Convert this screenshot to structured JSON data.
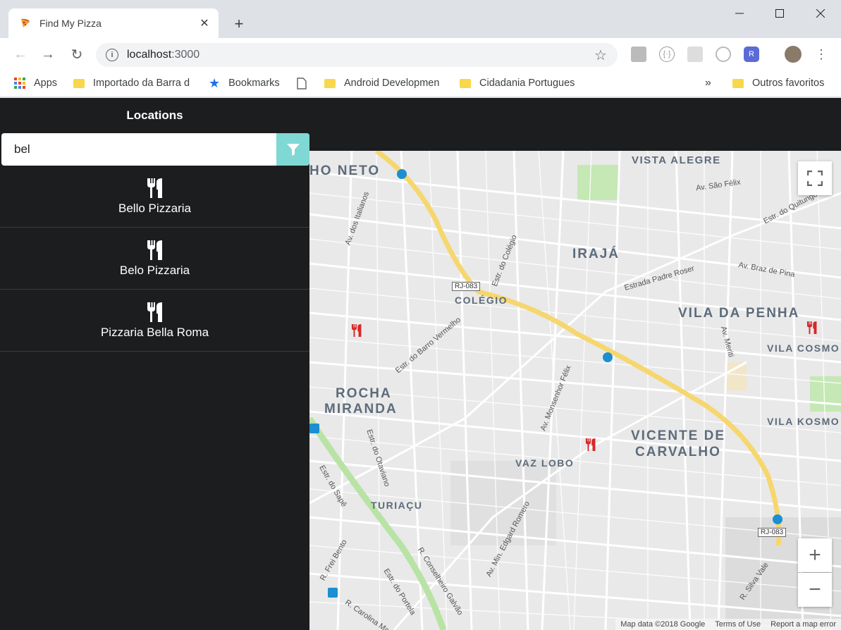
{
  "browser": {
    "tab_title": "Find My Pizza",
    "url_host": "localhost",
    "url_port": ":3000",
    "bookmarks": [
      "Apps",
      "Importado da Barra d",
      "Bookmarks",
      "Android Developmen",
      "Cidadania Portugues",
      "Outros favoritos"
    ],
    "overflow_label": "»"
  },
  "app": {
    "sidebar_title": "Locations",
    "search_value": "bel",
    "results": [
      {
        "name": "Bello Pizzaria"
      },
      {
        "name": "Belo Pizzaria"
      },
      {
        "name": "Pizzaria Bella Roma"
      }
    ]
  },
  "map": {
    "labels": [
      "HO NETO",
      "VISTA ALEGRE",
      "Av. São Félix",
      "Estr. do Quitungo",
      "Av. dos Italianos",
      "IRAJÁ",
      "Estr. do Colégio",
      "RJ-083",
      "Estrada Padre Roser",
      "Av. Braz de Pina",
      "COLÉGIO",
      "VILA DA PENHA",
      "VILA COSMO",
      "Estr. do Barro Vermelho",
      "Av. Monsenhor Félix",
      "ROCHA",
      "MIRANDA",
      "VILA KOSMO",
      "VICENTE DE",
      "CARVALHO",
      "VAZ LOBO",
      "Estr. do Otaviano",
      "TURIAÇU",
      "Estr. do Sapê",
      "Av. Min. Edgard Romero",
      "R. Conselheiro Galvão",
      "R. Frei Bento",
      "Estr. do Portela",
      "R. Carolina Ma",
      "R. Silva Vale",
      "Av. Meriti"
    ],
    "zoom_in": "+",
    "zoom_out": "−",
    "attribution": [
      "Map data ©2018 Google",
      "Terms of Use",
      "Report a map error"
    ],
    "colors": {
      "road_major": "#f6d76f",
      "park": "#c5e8b5",
      "pin": "#d62828",
      "filter": "#7fd8d4"
    }
  }
}
